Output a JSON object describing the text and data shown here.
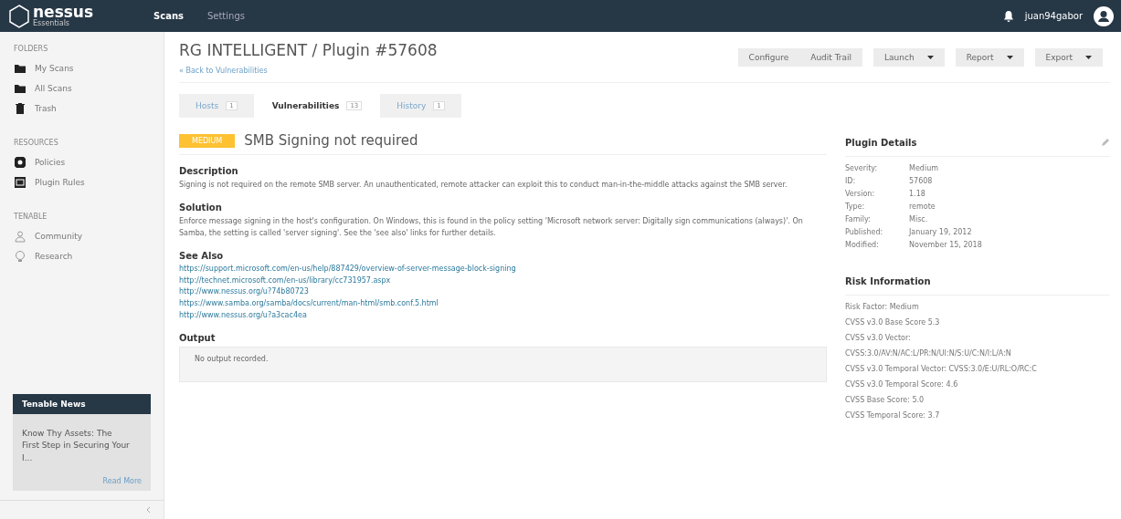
{
  "topbar": {
    "logo": "nessus",
    "logo_sub": "Essentials",
    "nav": [
      {
        "label": "Scans",
        "selected": true
      },
      {
        "label": "Settings",
        "selected": false
      }
    ],
    "user": "juan94gabor"
  },
  "sidebar": {
    "sections": [
      {
        "heading": "FOLDERS",
        "items": [
          {
            "label": "My Scans",
            "kind": "folder"
          },
          {
            "label": "All Scans",
            "kind": "folder"
          },
          {
            "label": "Trash",
            "kind": "trash"
          }
        ]
      },
      {
        "heading": "RESOURCES",
        "items": [
          {
            "label": "Policies",
            "kind": "shield"
          },
          {
            "label": "Plugin Rules",
            "kind": "rules"
          }
        ]
      },
      {
        "heading": "TENABLE",
        "items": [
          {
            "label": "Community",
            "kind": "people"
          },
          {
            "label": "Research",
            "kind": "bulb"
          }
        ]
      }
    ],
    "news": {
      "title": "Tenable News",
      "text": "Know Thy Assets: The First Step in Securing Your I...",
      "link": "Read More"
    }
  },
  "page": {
    "title": "RG INTELLIGENT / Plugin #57608",
    "back": "« Back to Vulnerabilities",
    "actions": [
      {
        "label": "Configure",
        "menu": false
      },
      {
        "label": "Audit Trail",
        "menu": false
      },
      {
        "label": "Launch",
        "menu": true
      },
      {
        "label": "Report",
        "menu": true
      },
      {
        "label": "Export",
        "menu": true
      }
    ],
    "tabs": [
      {
        "label": "Hosts",
        "count": "1",
        "selected": false
      },
      {
        "label": "Vulnerabilities",
        "count": "13",
        "selected": true
      },
      {
        "label": "History",
        "count": "1",
        "selected": false
      }
    ]
  },
  "plugin": {
    "severity": "MEDIUM",
    "name": "SMB Signing not required",
    "sections": [
      {
        "kind": "text",
        "heading": "Description",
        "text": "Signing is not required on the remote SMB server. An unauthenticated, remote attacker can exploit this to conduct man-in-the-middle attacks against the SMB server."
      },
      {
        "kind": "text",
        "heading": "Solution",
        "text": "Enforce message signing in the host's configuration. On Windows, this is found in the policy setting 'Microsoft network server: Digitally sign communications (always)'. On Samba, the setting is called 'server signing'. See the 'see also' links for further details."
      },
      {
        "kind": "links",
        "heading": "See Also",
        "links": [
          "https://support.microsoft.com/en-us/help/887429/overview-of-server-message-block-signing",
          "http://technet.microsoft.com/en-us/library/cc731957.aspx",
          "http://www.nessus.org/u?74b80723",
          "https://www.samba.org/samba/docs/current/man-html/smb.conf.5.html",
          "http://www.nessus.org/u?a3cac4ea"
        ]
      },
      {
        "kind": "output",
        "heading": "Output",
        "text": "No output recorded."
      }
    ]
  },
  "details": {
    "title": "Plugin Details",
    "rows": [
      {
        "label": "Severity:",
        "value": "Medium"
      },
      {
        "label": "ID:",
        "value": "57608"
      },
      {
        "label": "Version:",
        "value": "1.18"
      },
      {
        "label": "Type:",
        "value": "remote"
      },
      {
        "label": "Family:",
        "value": "Misc."
      },
      {
        "label": "Published:",
        "value": "January 19, 2012"
      },
      {
        "label": "Modified:",
        "value": "November 15, 2018"
      }
    ]
  },
  "risk": {
    "title": "Risk Information",
    "lines": [
      "Risk Factor: Medium",
      "CVSS v3.0 Base Score 5.3",
      "CVSS v3.0 Vector:",
      "CVSS:3.0/AV:N/AC:L/PR:N/UI:N/S:U/C:N/I:L/A:N",
      "CVSS v3.0 Temporal Vector: CVSS:3.0/E:U/RL:O/RC:C",
      "CVSS v3.0 Temporal Score: 4.6",
      "CVSS Base Score: 5.0",
      "CVSS Temporal Score: 3.7"
    ]
  }
}
